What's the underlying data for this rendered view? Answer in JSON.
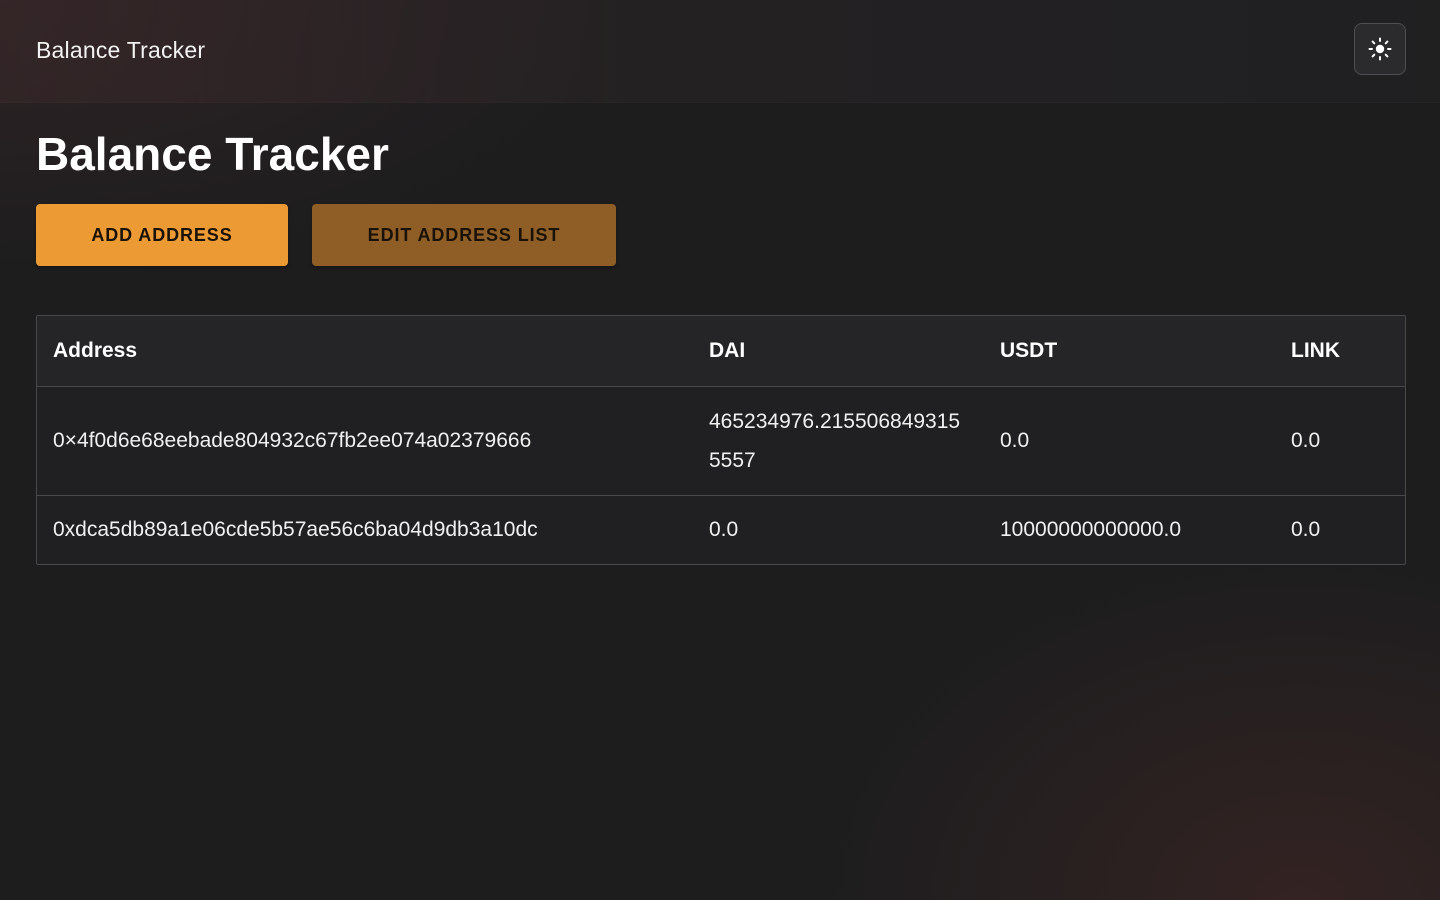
{
  "header": {
    "app_title": "Balance Tracker",
    "theme_toggle_icon": "sun-icon"
  },
  "main": {
    "title": "Balance Tracker",
    "buttons": {
      "add_address": "ADD ADDRESS",
      "edit_address_list": "EDIT ADDRESS LIST"
    },
    "table": {
      "headers": [
        "Address",
        "DAI",
        "USDT",
        "LINK"
      ],
      "rows": [
        [
          "0×4f0d6e68eebade804932c67fb2ee074a02379666",
          "465234976.2155068493155557",
          "0.0",
          "0.0"
        ],
        [
          "0xdca5db89a1e06cde5b57ae56c6ba04d9db3a10dc",
          "0.0",
          "10000000000000.0",
          "0.0"
        ]
      ]
    }
  },
  "colors": {
    "background": "#1d1d1e",
    "accent_primary": "#ec9a34",
    "accent_secondary": "#8f5e26",
    "table_border": "#48484b"
  }
}
